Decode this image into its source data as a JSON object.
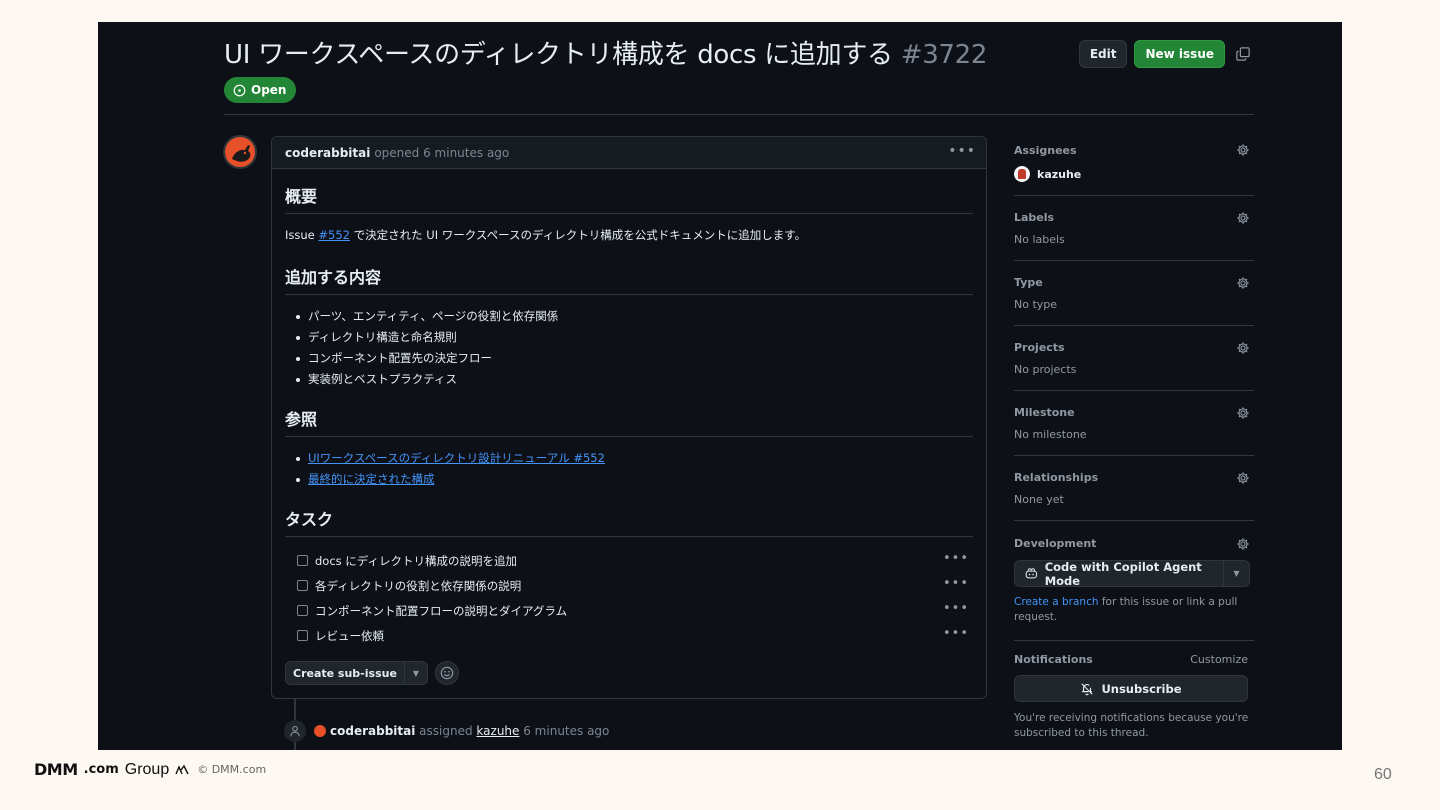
{
  "issue": {
    "title": "UI ワークスペースのディレクトリ構成を docs に追加する",
    "number": "#3722",
    "state": "Open",
    "edit_label": "Edit",
    "new_issue_label": "New issue"
  },
  "comment": {
    "author": "coderabbitai",
    "meta": "opened 6 minutes ago",
    "sections": {
      "summary_heading": "概要",
      "summary_prefix": "Issue ",
      "summary_link": "#552",
      "summary_suffix": " で決定された UI ワークスペースのディレクトリ構成を公式ドキュメントに追加します。",
      "content_heading": "追加する内容",
      "content_items": [
        "パーツ、エンティティ、ページの役割と依存関係",
        "ディレクトリ構造と命名規則",
        "コンポーネント配置先の決定フロー",
        "実装例とベストプラクティス"
      ],
      "ref_heading": "参照",
      "ref_items": [
        "UIワークスペースのディレクトリ設計リニューアル #552",
        "最終的に決定された構成"
      ],
      "task_heading": "タスク",
      "tasks": [
        "docs にディレクトリ構成の説明を追加",
        "各ディレクトリの役割と依存関係の説明",
        "コンポーネント配置フローの説明とダイアグラム",
        "レビュー依頼"
      ]
    },
    "create_sub_issue": "Create sub-issue"
  },
  "event": {
    "actor": "coderabbitai",
    "action": "assigned",
    "assignee": "kazuhe",
    "time": "6 minutes ago"
  },
  "sidebar": {
    "assignees": {
      "label": "Assignees",
      "value": "kazuhe"
    },
    "labels": {
      "label": "Labels",
      "value": "No labels"
    },
    "type": {
      "label": "Type",
      "value": "No type"
    },
    "projects": {
      "label": "Projects",
      "value": "No projects"
    },
    "milestone": {
      "label": "Milestone",
      "value": "No milestone"
    },
    "relationships": {
      "label": "Relationships",
      "value": "None yet"
    },
    "development": {
      "label": "Development",
      "button": "Code with Copilot Agent Mode",
      "link": "Create a branch",
      "note": " for this issue or link a pull request."
    },
    "notifications": {
      "label": "Notifications",
      "customize": "Customize",
      "button": "Unsubscribe",
      "note": "You're receiving notifications because you're subscribed to this thread."
    }
  },
  "footer": {
    "logo_dmm": "DMM",
    "logo_com": ".com",
    "logo_group": "Group",
    "copyright": "© DMM.com",
    "page": "60"
  },
  "colors": {
    "page_bg": "#fdf9f2",
    "screen_bg": "#0d1117",
    "accent_green": "#238636",
    "link_blue": "#4493f8",
    "avatar_orange": "#e8502a"
  }
}
